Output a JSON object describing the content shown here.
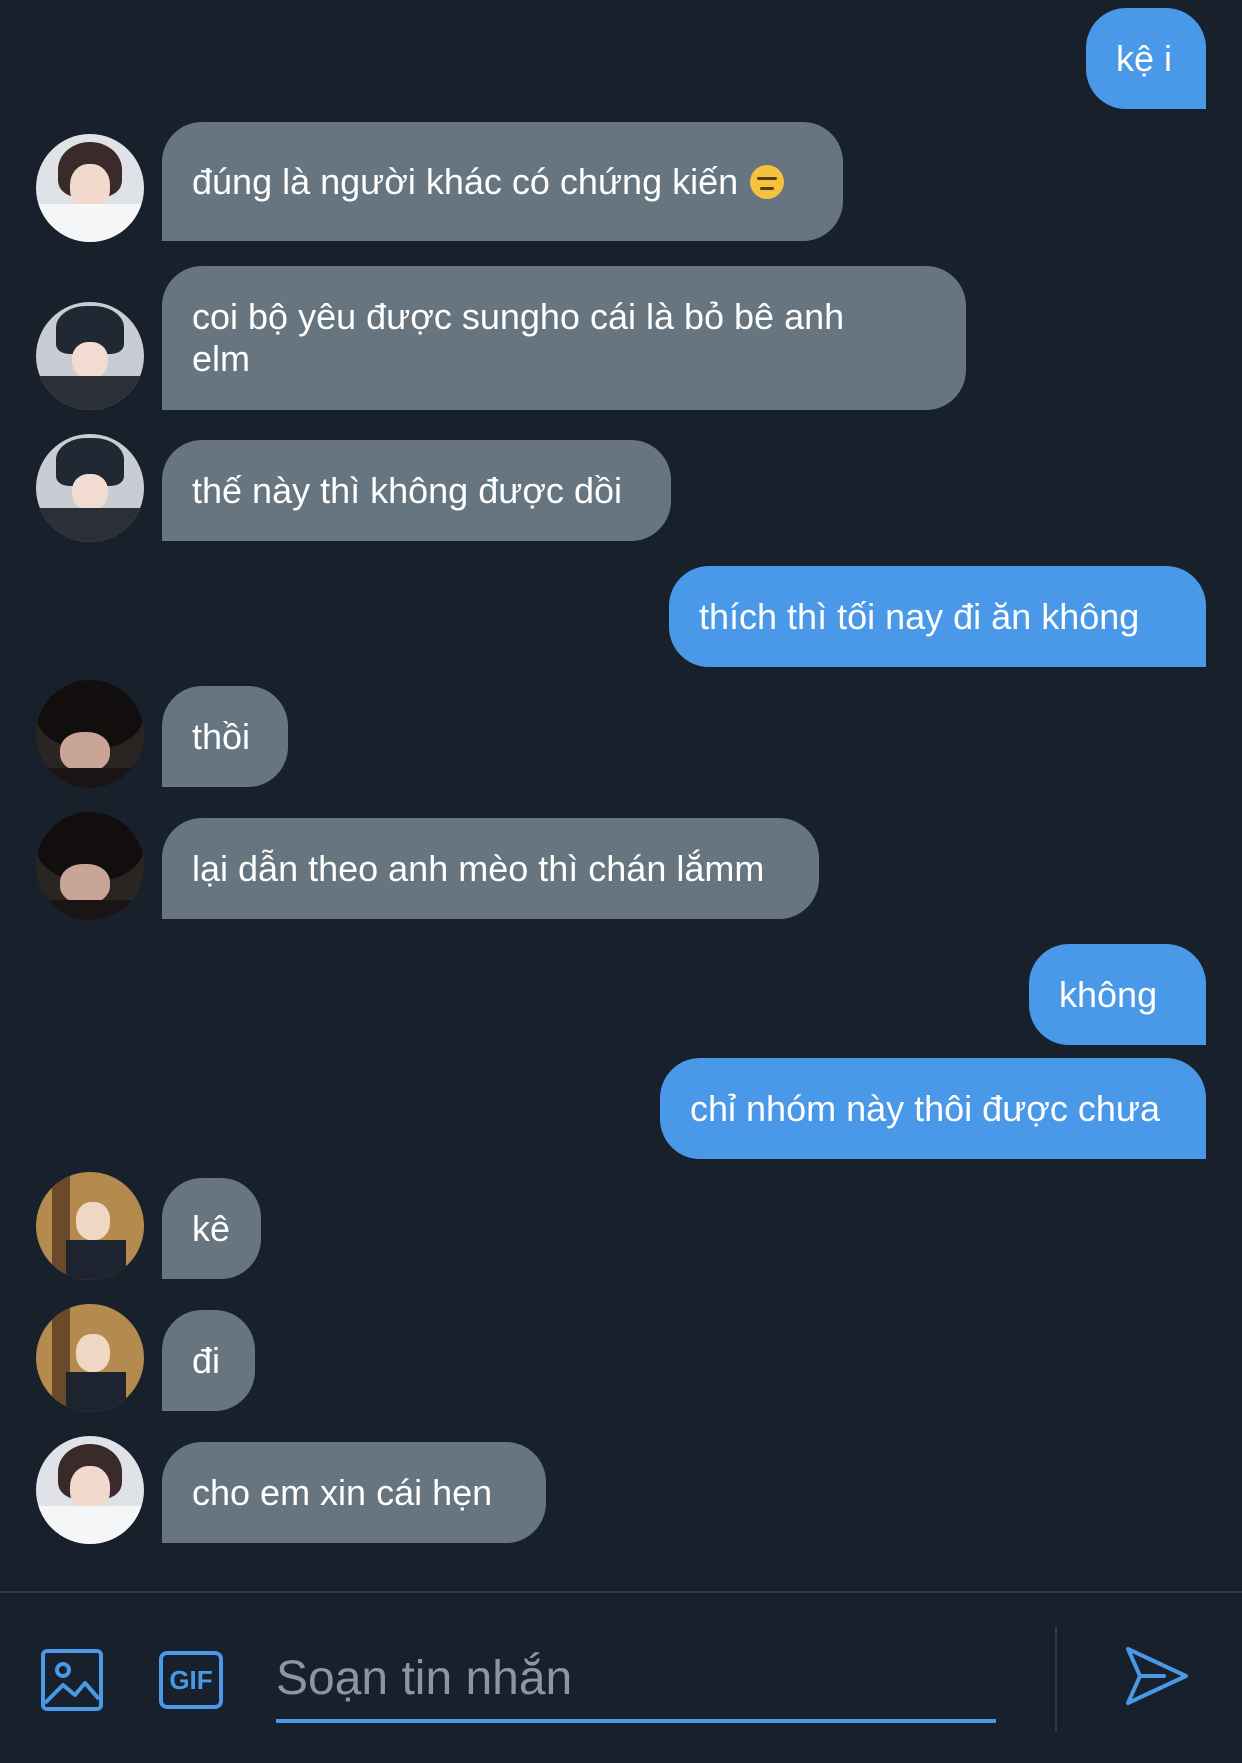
{
  "messages": [
    {
      "side": "sent",
      "text": "kệ i"
    },
    {
      "side": "received",
      "avatar": "avatar-a",
      "text": "đúng là người khác có chứng kiến",
      "emoji": "expressionless-face-emoji"
    },
    {
      "side": "received",
      "avatar": "avatar-b",
      "text": "coi bộ yêu được sungho cái là bỏ bê anh elm"
    },
    {
      "side": "received",
      "avatar": "avatar-b",
      "text": "thế này thì không được dồi"
    },
    {
      "side": "sent",
      "text": "thích thì tối nay đi ăn không"
    },
    {
      "side": "received",
      "avatar": "avatar-c",
      "text": "thồi"
    },
    {
      "side": "received",
      "avatar": "avatar-c",
      "text": "lại dẫn theo anh mèo thì chán lắmm"
    },
    {
      "side": "sent",
      "text": "không"
    },
    {
      "side": "sent",
      "text": "chỉ nhóm này thôi được chưa"
    },
    {
      "side": "received",
      "avatar": "avatar-d",
      "text": "kê"
    },
    {
      "side": "received",
      "avatar": "avatar-d",
      "text": "đi"
    },
    {
      "side": "received",
      "avatar": "avatar-a",
      "text": "cho em xin cái hẹn"
    }
  ],
  "composer": {
    "gif_label": "GIF",
    "placeholder": "Soạn tin nhắn",
    "icons": [
      "image-icon",
      "gif-icon",
      "send-icon"
    ]
  },
  "colors": {
    "background": "#17202b",
    "sent_bubble": "#4a99e9",
    "received_bubble": "#66757f",
    "accent": "#4a99e9"
  }
}
